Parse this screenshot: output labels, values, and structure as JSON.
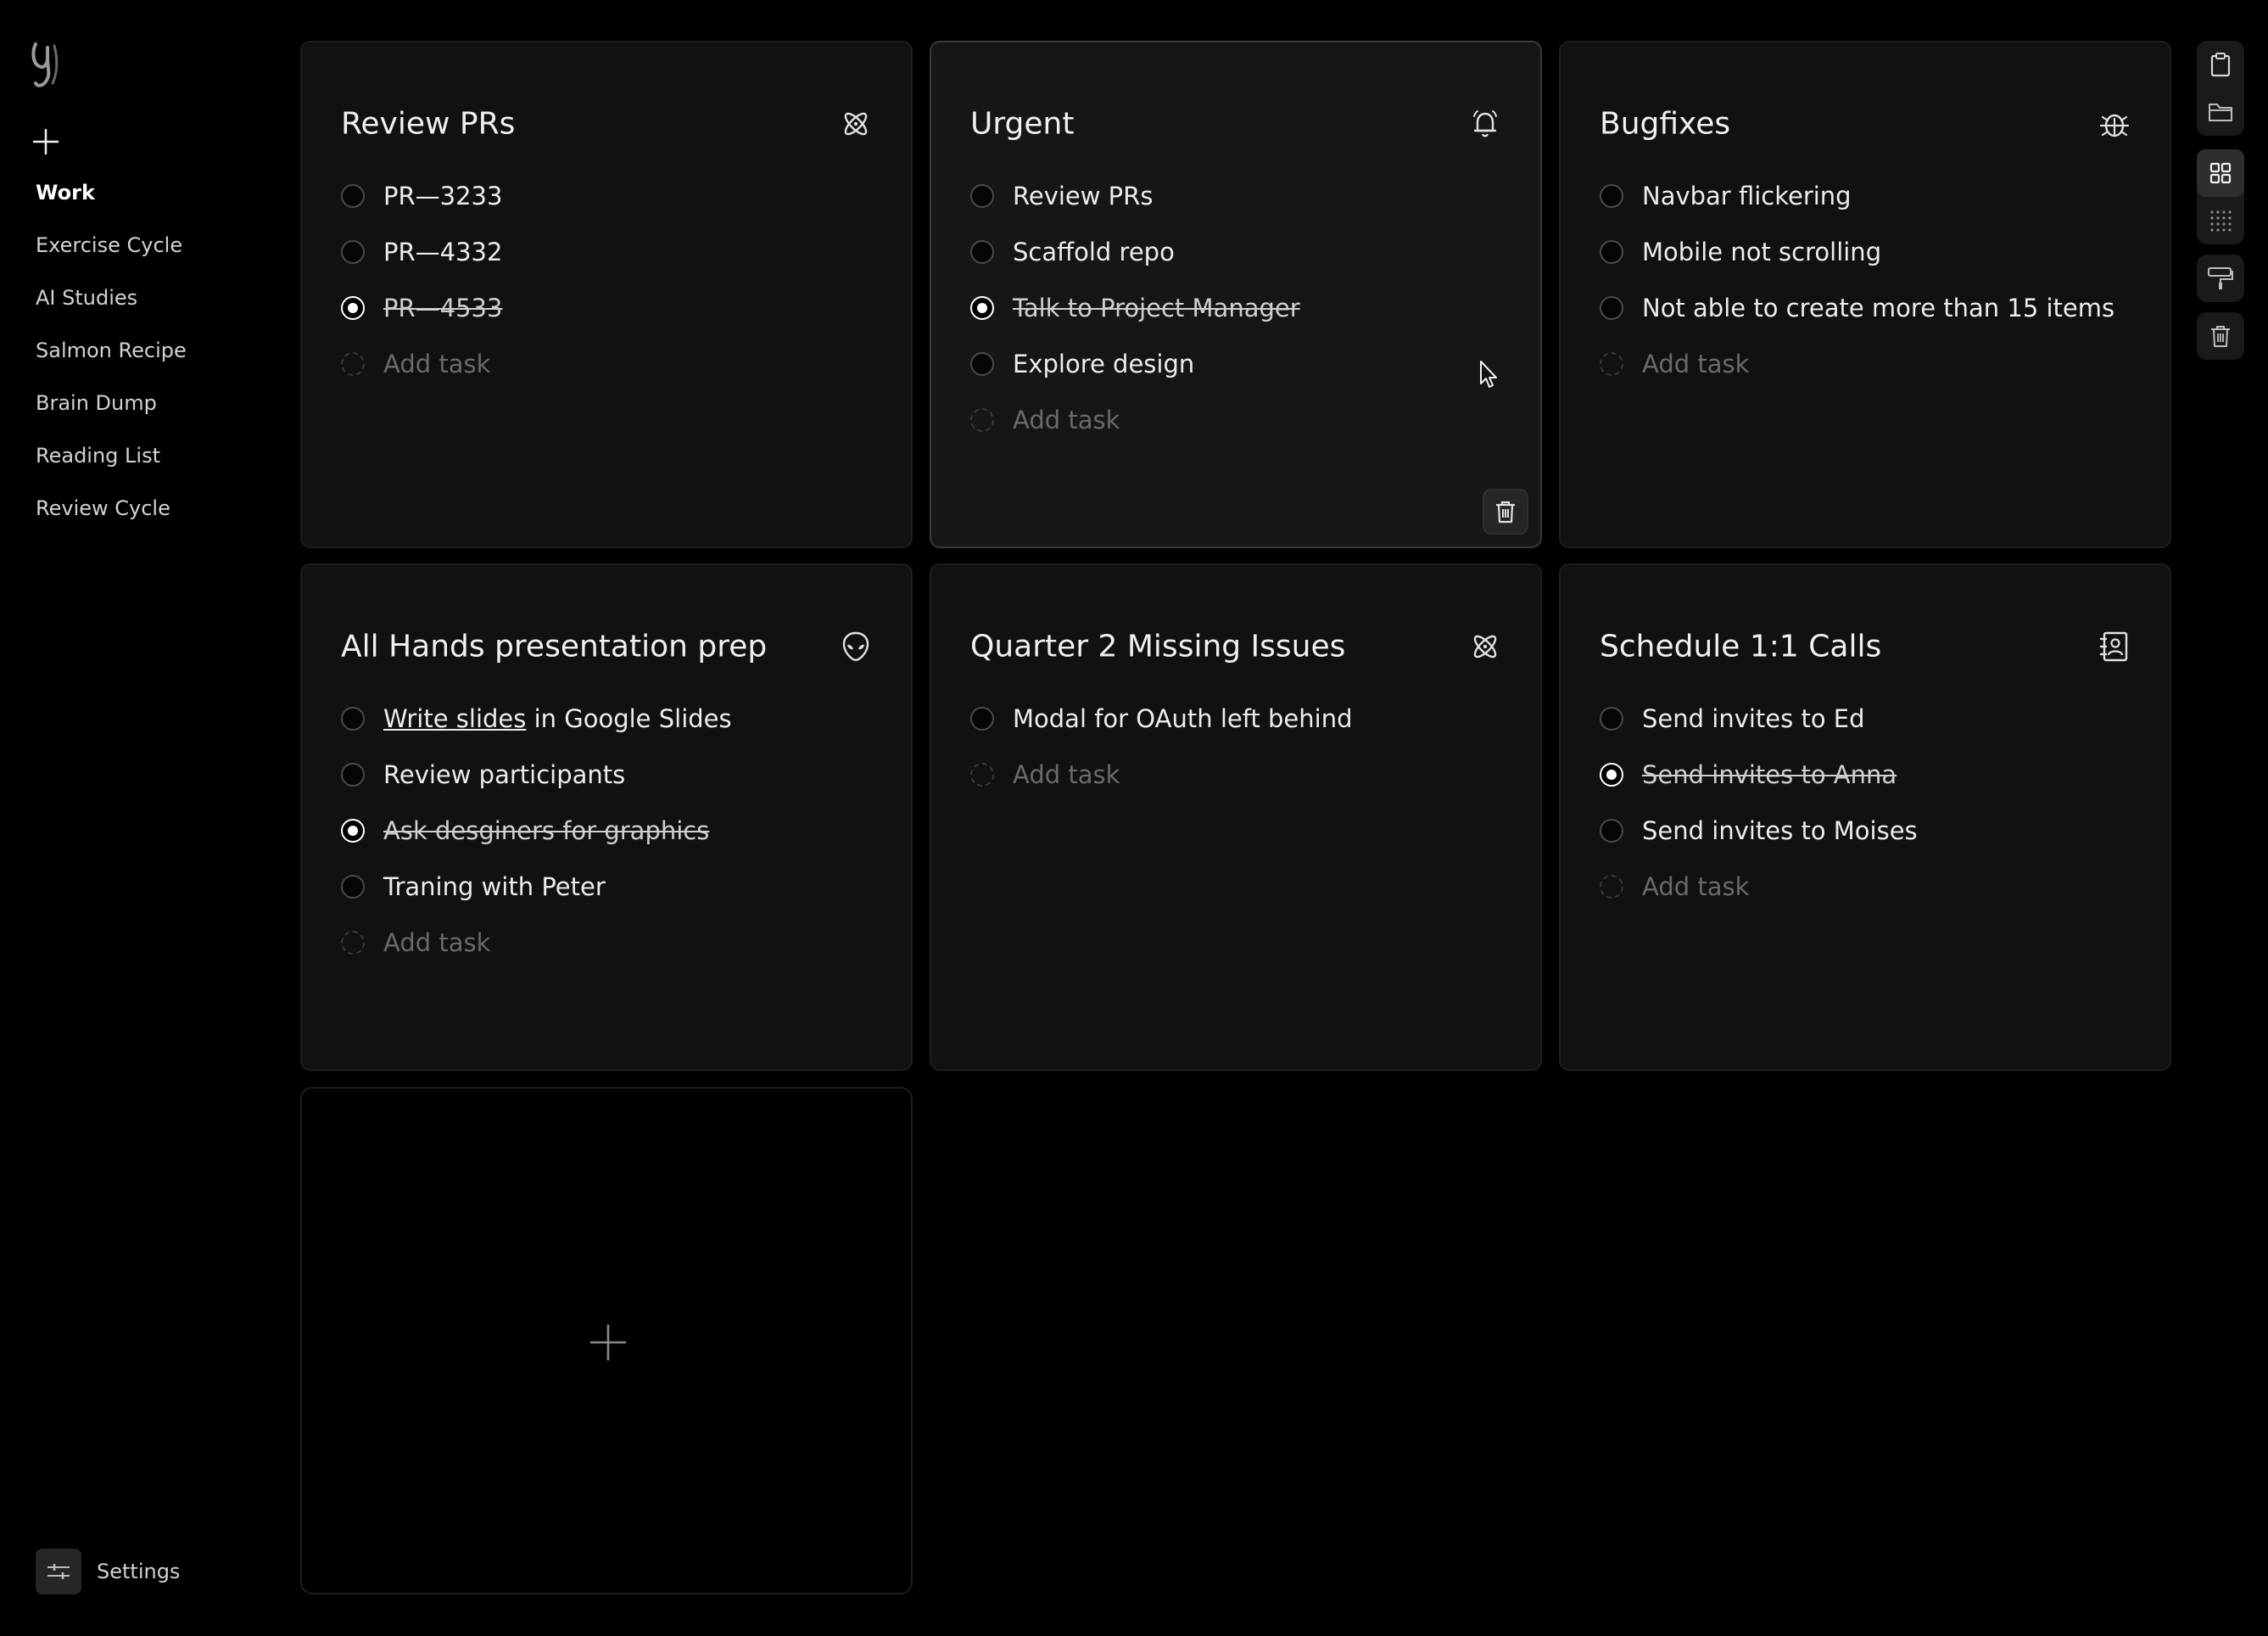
{
  "sidebar": {
    "logo": "g-logo",
    "add_label": "+",
    "items": [
      {
        "label": "Work",
        "active": true
      },
      {
        "label": "Exercise Cycle"
      },
      {
        "label": "AI Studies"
      },
      {
        "label": "Salmon Recipe"
      },
      {
        "label": "Brain Dump"
      },
      {
        "label": "Reading List"
      },
      {
        "label": "Review Cycle"
      }
    ],
    "settings_label": "Settings"
  },
  "cards": [
    {
      "title": "Review PRs",
      "icon": "atom-icon",
      "tasks": [
        {
          "text": "PR—3233",
          "done": false
        },
        {
          "text": "PR—4332",
          "done": false
        },
        {
          "text": "PR—4533",
          "done": true
        }
      ],
      "add_placeholder": "Add task"
    },
    {
      "title": "Urgent",
      "icon": "bell-icon",
      "tasks": [
        {
          "text": "Review PRs",
          "done": false
        },
        {
          "text": "Scaffold repo",
          "done": false
        },
        {
          "text": "Talk to Project Manager",
          "done": true
        },
        {
          "text": "Explore design",
          "done": false
        }
      ],
      "add_placeholder": "Add task"
    },
    {
      "title": "Bugfixes",
      "icon": "bug-icon",
      "tasks": [
        {
          "text": "Navbar flickering",
          "done": false
        },
        {
          "text": "Mobile not scrolling",
          "done": false
        },
        {
          "text": "Not able to create more than 15 items",
          "done": false
        }
      ],
      "add_placeholder": "Add task"
    },
    {
      "title": "All Hands presentation prep",
      "icon": "alien-icon",
      "tasks": [
        {
          "link_text": "Write slides",
          "rest_text": " in Google Slides",
          "done": false
        },
        {
          "text": "Review participants",
          "done": false
        },
        {
          "text": "Ask desginers for graphics",
          "done": true
        },
        {
          "text": "Traning with Peter",
          "done": false
        }
      ],
      "add_placeholder": "Add task"
    },
    {
      "title": "Quarter 2 Missing Issues",
      "icon": "atom-icon",
      "tasks": [
        {
          "text": "Modal for OAuth left behind",
          "done": false
        }
      ],
      "add_placeholder": "Add task"
    },
    {
      "title": "Schedule 1:1 Calls",
      "icon": "contact-book-icon",
      "tasks": [
        {
          "text": "Send invites to Ed",
          "done": false
        },
        {
          "text": "Send invites to Anna",
          "done": true
        },
        {
          "text": "Send invites to Moises",
          "done": false
        }
      ],
      "add_placeholder": "Add task"
    }
  ],
  "toolbar": {
    "tools": [
      "clipboard-icon",
      "folder-icon",
      "grid-icon",
      "dot-grid-icon",
      "paint-roller-icon",
      "trash-icon"
    ],
    "active": "grid-icon"
  }
}
